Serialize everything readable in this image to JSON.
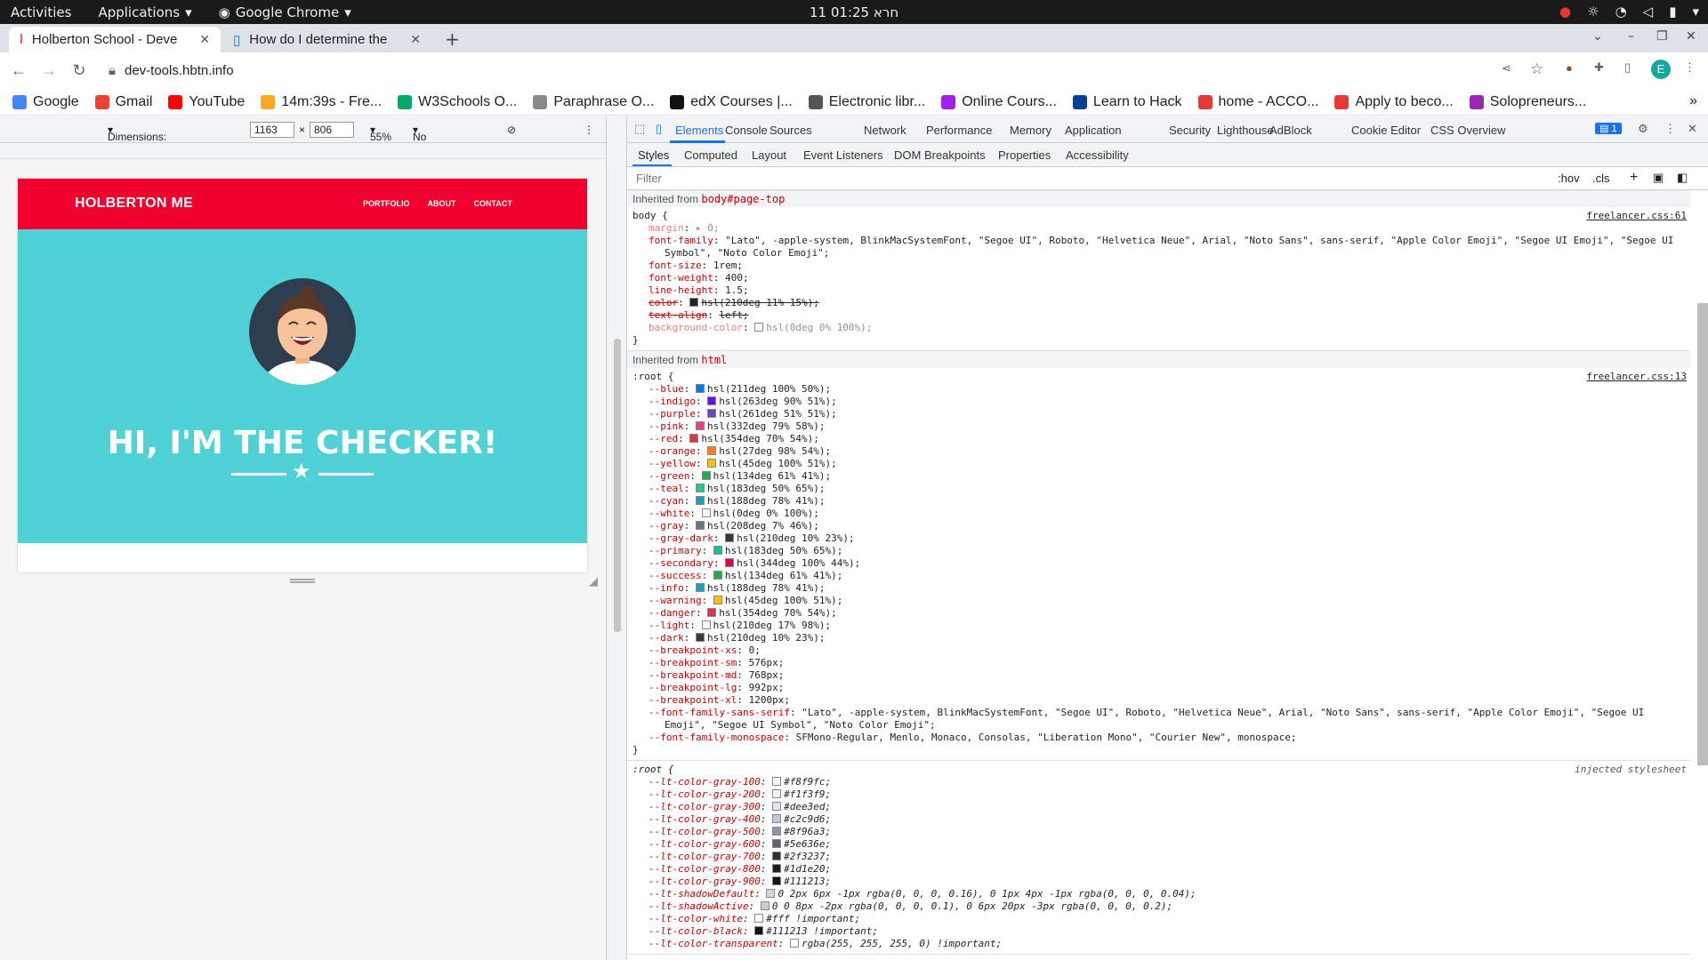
{
  "topbar": {
    "activities": "Activities",
    "applications": "Applications",
    "chrome": "Google Chrome",
    "clock": "11 חרא 01:25"
  },
  "tabs": [
    {
      "title": "Holberton School - Deve"
    },
    {
      "title": "How do I determine the"
    }
  ],
  "address": {
    "url": "dev-tools.hbtn.info"
  },
  "bookmarks": [
    {
      "label": "Google",
      "color": "#4285f4"
    },
    {
      "label": "Gmail",
      "color": "#ea4335"
    },
    {
      "label": "YouTube",
      "color": "#ff0000"
    },
    {
      "label": "14m:39s - Fre...",
      "color": "#f9a825"
    },
    {
      "label": "W3Schools O...",
      "color": "#04aa6d"
    },
    {
      "label": "Paraphrase O...",
      "color": "#888888"
    },
    {
      "label": "edX Courses |...",
      "color": "#111111"
    },
    {
      "label": "Electronic libr...",
      "color": "#555555"
    },
    {
      "label": "Online Cours...",
      "color": "#a020f0"
    },
    {
      "label": "Learn to Hack",
      "color": "#0b3d91"
    },
    {
      "label": "home - ACCO...",
      "color": "#e53935"
    },
    {
      "label": "Apply to beco...",
      "color": "#e53935"
    },
    {
      "label": "Solopreneurs...",
      "color": "#9c27b0"
    }
  ],
  "device": {
    "dimensions": "Dimensions: Responsive",
    "width": "1163",
    "height": "806",
    "zoom": "55%",
    "throttle": "No throttling"
  },
  "site": {
    "brand": "HOLBERTON ME",
    "links": [
      "PORTFOLIO",
      "ABOUT",
      "CONTACT"
    ],
    "headline": "HI, I'M THE CHECKER!"
  },
  "devtools": {
    "tabs": [
      "Elements",
      "Console",
      "Sources",
      "Network",
      "Performance",
      "Memory",
      "Application",
      "Security",
      "Lighthouse",
      "AdBlock",
      "Cookie Editor",
      "CSS Overview"
    ],
    "badge": "1",
    "subtabs": [
      "Styles",
      "Computed",
      "Layout",
      "Event Listeners",
      "DOM Breakpoints",
      "Properties",
      "Accessibility"
    ],
    "filter": "Filter",
    "hov": ":hov",
    "cls": ".cls"
  },
  "styles": {
    "inh1": "Inherited from ",
    "inh1b": "body#page-top",
    "body_sel": "body {",
    "body_src": "freelancer.css:61",
    "body_props": [
      {
        "n": "margin",
        "v": "▸ 0;",
        "k": "dim2"
      },
      {
        "n": "font-family",
        "v": "\"Lato\", -apple-system, BlinkMacSystemFont, \"Segoe UI\", Roboto, \"Helvetica Neue\", Arial, \"Noto Sans\", sans-serif, \"Apple Color Emoji\", \"Segoe UI Emoji\", \"Segoe UI",
        "k": ""
      },
      {
        "n": "",
        "v": "Symbol\", \"Noto Color Emoji\";",
        "k": ""
      },
      {
        "n": "font-size",
        "v": "1rem;",
        "k": ""
      },
      {
        "n": "font-weight",
        "v": "400;",
        "k": ""
      },
      {
        "n": "line-height",
        "v": "1.5;",
        "k": ""
      },
      {
        "n": "color",
        "v": "hsl(210deg 11% 15%);",
        "k": "st",
        "c": "#212529"
      },
      {
        "n": "text-align",
        "v": "left;",
        "k": "st"
      },
      {
        "n": "background-color",
        "v": "hsl(0deg 0% 100%);",
        "k": "dim2",
        "c": "#ffffff"
      }
    ],
    "inh2": "Inherited from ",
    "inh2b": "html",
    "root_sel": ":root {",
    "root_src": "freelancer.css:13",
    "root_props": [
      {
        "n": "--blue",
        "v": "hsl(211deg 100% 50%);",
        "c": "#007bff"
      },
      {
        "n": "--indigo",
        "v": "hsl(263deg 90% 51%);",
        "c": "#6610f2"
      },
      {
        "n": "--purple",
        "v": "hsl(261deg 51% 51%);",
        "c": "#6f42c1"
      },
      {
        "n": "--pink",
        "v": "hsl(332deg 79% 58%);",
        "c": "#e83e8c"
      },
      {
        "n": "--red",
        "v": "hsl(354deg 70% 54%);",
        "c": "#dc3545"
      },
      {
        "n": "--orange",
        "v": "hsl(27deg 98% 54%);",
        "c": "#fd7e14"
      },
      {
        "n": "--yellow",
        "v": "hsl(45deg 100% 51%);",
        "c": "#ffc107"
      },
      {
        "n": "--green",
        "v": "hsl(134deg 61% 41%);",
        "c": "#28a745"
      },
      {
        "n": "--teal",
        "v": "hsl(183deg 50% 65%);",
        "c": "#20c997"
      },
      {
        "n": "--cyan",
        "v": "hsl(188deg 78% 41%);",
        "c": "#17a2b8"
      },
      {
        "n": "--white",
        "v": "hsl(0deg 0% 100%);",
        "c": "#ffffff"
      },
      {
        "n": "--gray",
        "v": "hsl(208deg 7% 46%);",
        "c": "#6c757d"
      },
      {
        "n": "--gray-dark",
        "v": "hsl(210deg 10% 23%);",
        "c": "#343a40"
      },
      {
        "n": "--primary",
        "v": "hsl(183deg 50% 65%);",
        "c": "#1abc9c"
      },
      {
        "n": "--secondary",
        "v": "hsl(344deg 100% 44%);",
        "c": "#e0004d"
      },
      {
        "n": "--success",
        "v": "hsl(134deg 61% 41%);",
        "c": "#28a745"
      },
      {
        "n": "--info",
        "v": "hsl(188deg 78% 41%);",
        "c": "#17a2b8"
      },
      {
        "n": "--warning",
        "v": "hsl(45deg 100% 51%);",
        "c": "#ffc107"
      },
      {
        "n": "--danger",
        "v": "hsl(354deg 70% 54%);",
        "c": "#dc3545"
      },
      {
        "n": "--light",
        "v": "hsl(210deg 17% 98%);",
        "c": "#f8f9fa"
      },
      {
        "n": "--dark",
        "v": "hsl(210deg 10% 23%);",
        "c": "#343a40"
      },
      {
        "n": "--breakpoint-xs",
        "v": "0;"
      },
      {
        "n": "--breakpoint-sm",
        "v": "576px;"
      },
      {
        "n": "--breakpoint-md",
        "v": "768px;"
      },
      {
        "n": "--breakpoint-lg",
        "v": "992px;"
      },
      {
        "n": "--breakpoint-xl",
        "v": "1200px;"
      },
      {
        "n": "--font-family-sans-serif",
        "v": "\"Lato\", -apple-system, BlinkMacSystemFont, \"Segoe UI\", Roboto, \"Helvetica Neue\", Arial, \"Noto Sans\", sans-serif, \"Apple Color Emoji\", \"Segoe UI"
      },
      {
        "n": "",
        "v": "Emoji\", \"Segoe UI Symbol\", \"Noto Color Emoji\";"
      },
      {
        "n": "--font-family-monospace",
        "v": "SFMono-Regular, Menlo, Monaco, Consolas, \"Liberation Mono\", \"Courier New\", monospace;"
      }
    ],
    "inj_sel": ":root {",
    "inj_src": "injected stylesheet",
    "inj_props": [
      {
        "n": "--lt-color-gray-100",
        "v": "#f8f9fc;",
        "c": "#f8f9fc"
      },
      {
        "n": "--lt-color-gray-200",
        "v": "#f1f3f9;",
        "c": "#f1f3f9"
      },
      {
        "n": "--lt-color-gray-300",
        "v": "#dee3ed;",
        "c": "#dee3ed"
      },
      {
        "n": "--lt-color-gray-400",
        "v": "#c2c9d6;",
        "c": "#c2c9d6"
      },
      {
        "n": "--lt-color-gray-500",
        "v": "#8f96a3;",
        "c": "#8f96a3"
      },
      {
        "n": "--lt-color-gray-600",
        "v": "#5e636e;",
        "c": "#5e636e"
      },
      {
        "n": "--lt-color-gray-700",
        "v": "#2f3237;",
        "c": "#2f3237"
      },
      {
        "n": "--lt-color-gray-800",
        "v": "#1d1e20;",
        "c": "#1d1e20"
      },
      {
        "n": "--lt-color-gray-900",
        "v": "#111213;",
        "c": "#111213"
      },
      {
        "n": "--lt-shadowDefault",
        "v": "0 2px 6px -1px rgba(0, 0, 0, 0.16), 0 1px 4px -1px rgba(0, 0, 0, 0.04);",
        "c": "#d6d6d6"
      },
      {
        "n": "--lt-shadowActive",
        "v": "0 0 8px -2px rgba(0, 0, 0, 0.1), 0 6px 20px -3px rgba(0, 0, 0, 0.2);",
        "c": "#cccccc"
      },
      {
        "n": "--lt-color-white",
        "v": "#fff !important;",
        "c": "#ffffff"
      },
      {
        "n": "--lt-color-black",
        "v": "#111213 !important;",
        "c": "#111213"
      },
      {
        "n": "--lt-color-transparent",
        "v": "rgba(255, 255, 255, 0) !important;",
        "c": "#ffffff"
      }
    ]
  }
}
